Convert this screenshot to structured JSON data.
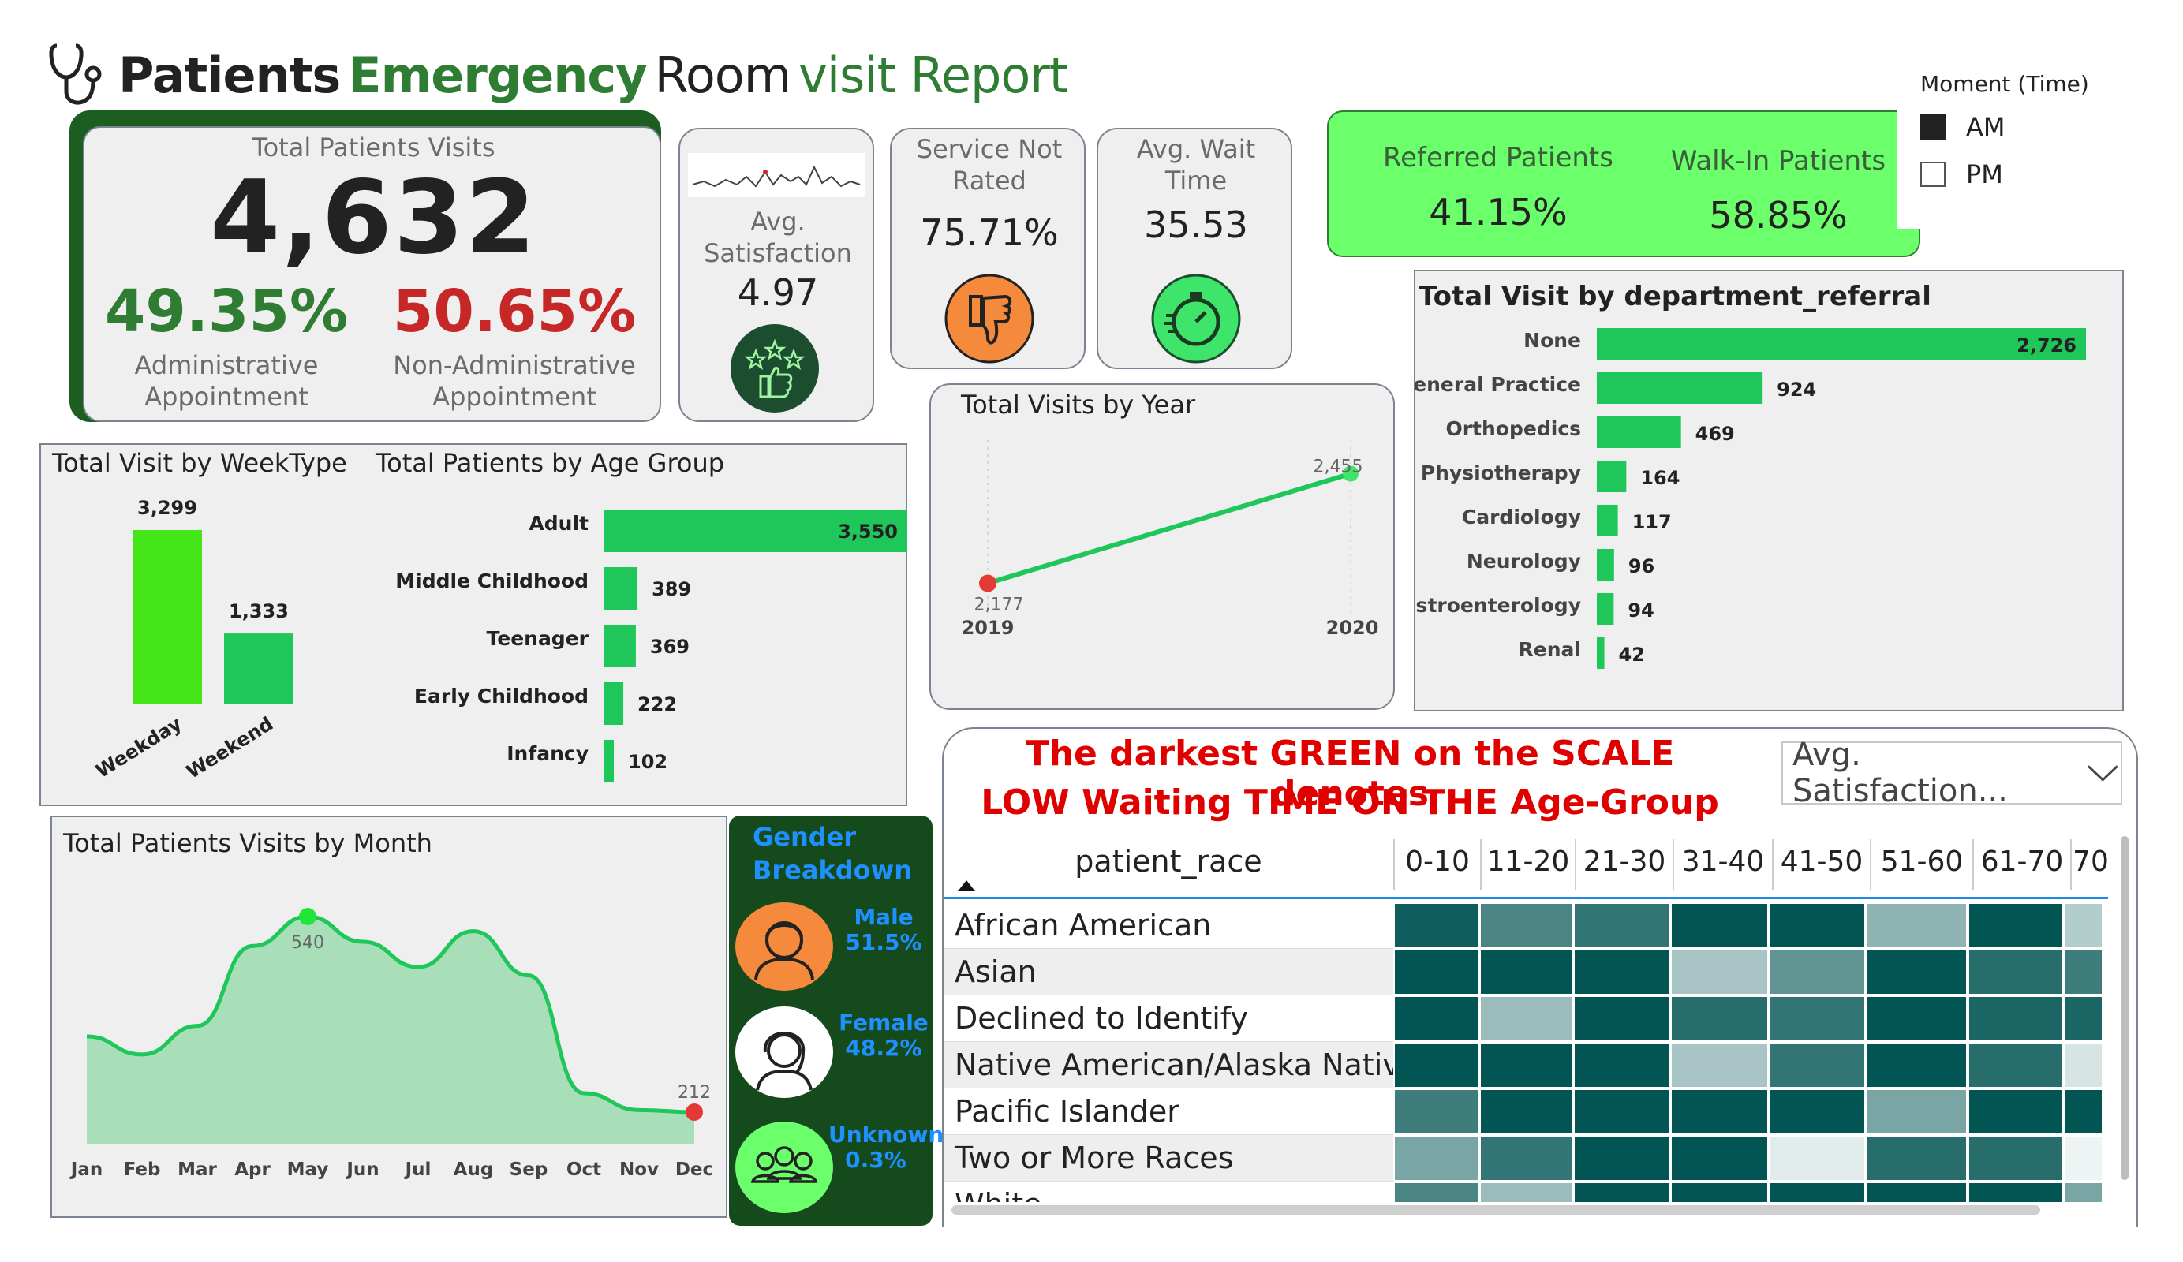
{
  "header": {
    "title_w1": "Patients",
    "title_w2": "Emergency",
    "title_w3": "Room",
    "title_w4": "visit Report",
    "icon": "stethoscope-icon"
  },
  "kpis": {
    "total_visits_label": "Total Patients Visits",
    "total_visits_value": "4,632",
    "admin_pct": "49.35%",
    "admin_label_1": "Administrative",
    "admin_label_2": "Appointment",
    "non_admin_pct": "50.65%",
    "non_admin_label_1": "Non-Administrative",
    "non_admin_label_2": "Appointment",
    "satisfaction_label_1": "Avg.",
    "satisfaction_label_2": "Satisfaction",
    "satisfaction_value": "4.97",
    "not_rated_label_1": "Service Not",
    "not_rated_label_2": "Rated",
    "not_rated_value": "75.71%",
    "wait_label_1": "Avg. Wait",
    "wait_label_2": "Time",
    "wait_value": "35.53",
    "referred_label": "Referred Patients",
    "referred_value": "41.15%",
    "walkin_label": "Walk-In Patients",
    "walkin_value": "58.85%"
  },
  "slicer": {
    "title": "Moment (Time)",
    "options": [
      "AM",
      "PM"
    ],
    "selected": "AM"
  },
  "department": {
    "title": "Total Visit by department_referral",
    "labels": [
      "None",
      "General Practice",
      "Orthopedics",
      "Physiotherapy",
      "Cardiology",
      "Neurology",
      "Gastroenterology",
      "Renal"
    ],
    "value_labels": [
      "2,726",
      "924",
      "469",
      "164",
      "117",
      "96",
      "94",
      "42"
    ]
  },
  "year_chart": {
    "title": "Total Visits by Year",
    "x_labels": [
      "2019",
      "2020"
    ],
    "value_labels": [
      "2,177",
      "2,455"
    ]
  },
  "weektype": {
    "title": "Total Visit by WeekType",
    "labels": [
      "Weekday",
      "Weekend"
    ],
    "value_labels": [
      "3,299",
      "1,333"
    ]
  },
  "age_group": {
    "title": "Total Patients by Age Group",
    "labels": [
      "Adult",
      "Middle Childhood",
      "Teenager",
      "Early Childhood",
      "Infancy"
    ],
    "value_labels": [
      "3,550",
      "389",
      "369",
      "222",
      "102"
    ]
  },
  "month_chart": {
    "title": "Total Patients Visits by Month",
    "months": [
      "Jan",
      "Feb",
      "Mar",
      "Apr",
      "May",
      "Jun",
      "Jul",
      "Aug",
      "Sep",
      "Oct",
      "Nov",
      "Dec"
    ],
    "max_label": "540",
    "min_label": "212"
  },
  "gender": {
    "title_1": "Gender",
    "title_2": "Breakdown",
    "male_label": "Male",
    "male_value": "51.5%",
    "female_label": "Female",
    "female_value": "48.2%",
    "unknown_label": "Unknown",
    "unknown_value": "0.3%"
  },
  "heatmap": {
    "note_1": "The darkest GREEN on the SCALE denotes",
    "note_2": "LOW Waiting TIME ON THE Age-Group",
    "dropdown_value": "Avg. Satisfaction...",
    "row_header": "patient_race",
    "columns": [
      "0-10",
      "11-20",
      "21-30",
      "31-40",
      "41-50",
      "51-60",
      "61-70",
      "70"
    ],
    "rows": [
      "African American",
      "Asian",
      "Declined to Identify",
      "Native American/Alaska Native",
      "Pacific Islander",
      "Two or More Races",
      "White"
    ]
  },
  "chart_data": [
    {
      "type": "bar",
      "title": "Total Visit by department_referral",
      "categories": [
        "None",
        "General Practice",
        "Orthopedics",
        "Physiotherapy",
        "Cardiology",
        "Neurology",
        "Gastroenterology",
        "Renal"
      ],
      "values": [
        2726,
        924,
        469,
        164,
        117,
        96,
        94,
        42
      ],
      "orientation": "horizontal"
    },
    {
      "type": "line",
      "title": "Total Visits by Year",
      "x": [
        2019,
        2020
      ],
      "values": [
        2177,
        2455
      ]
    },
    {
      "type": "bar",
      "title": "Total Visit by WeekType",
      "categories": [
        "Weekday",
        "Weekend"
      ],
      "values": [
        3299,
        1333
      ]
    },
    {
      "type": "bar",
      "title": "Total Patients by Age Group",
      "categories": [
        "Adult",
        "Middle Childhood",
        "Teenager",
        "Early Childhood",
        "Infancy"
      ],
      "values": [
        3550,
        389,
        369,
        222,
        102
      ],
      "orientation": "horizontal"
    },
    {
      "type": "area",
      "title": "Total Patients Visits by Month",
      "categories": [
        "Jan",
        "Feb",
        "Mar",
        "Apr",
        "May",
        "Jun",
        "Jul",
        "Aug",
        "Sep",
        "Oct",
        "Nov",
        "Dec"
      ],
      "values": [
        255,
        212,
        280,
        470,
        540,
        480,
        420,
        505,
        400,
        120,
        80,
        75
      ],
      "ylim": [
        0,
        600
      ]
    },
    {
      "type": "heatmap",
      "title": "Avg. Satisfaction by patient_race and age group",
      "x": [
        "0-10",
        "11-20",
        "21-30",
        "31-40",
        "41-50",
        "51-60",
        "61-70",
        "70"
      ],
      "y": [
        "African American",
        "Asian",
        "Declined to Identify",
        "Native American/Alaska Native",
        "Pacific Islander",
        "Two or More Races",
        "White"
      ],
      "intensity": [
        [
          0.95,
          0.7,
          0.8,
          1.0,
          1.0,
          0.4,
          1.0,
          0.25
        ],
        [
          1.0,
          1.0,
          1.0,
          0.3,
          0.6,
          1.0,
          0.85,
          0.75
        ],
        [
          1.0,
          0.35,
          1.0,
          0.85,
          0.8,
          1.0,
          0.9,
          0.9
        ],
        [
          1.0,
          1.0,
          1.0,
          0.3,
          0.8,
          1.0,
          0.85,
          0.1
        ],
        [
          0.75,
          1.0,
          1.0,
          1.0,
          1.0,
          0.5,
          1.0,
          1.0
        ],
        [
          0.5,
          0.8,
          1.0,
          1.0,
          0.05,
          0.85,
          0.85,
          0.0
        ],
        [
          0.7,
          0.35,
          1.0,
          1.0,
          1.0,
          1.0,
          1.0,
          0.5
        ]
      ]
    }
  ],
  "colors": {
    "green_bright": "#1fc65a",
    "green_lime": "#45e619",
    "green_dark": "#2e7d32",
    "red": "#c62828",
    "panel_green": "#6cff6c",
    "heat_dark": "#035554"
  }
}
